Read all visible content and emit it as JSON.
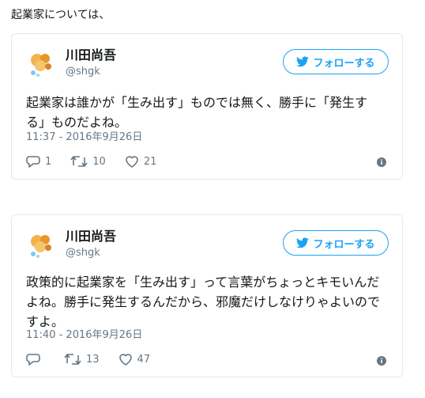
{
  "intro": "起業家については、",
  "colors": {
    "link_blue": "#1da1f2",
    "muted": "#657786",
    "border": "#e1e8ed"
  },
  "tweets": [
    {
      "author_name": "川田尚吾",
      "handle": "@shgk",
      "follow_label": "フォローする",
      "text": "起業家は誰かが「生み出す」ものでは無く、勝手に「発生する」ものだよね。",
      "timestamp": "11:37 - 2016年9月26日",
      "replies": "1",
      "retweets": "10",
      "likes": "21"
    },
    {
      "author_name": "川田尚吾",
      "handle": "@shgk",
      "follow_label": "フォローする",
      "text": "政策的に起業家を「生み出す」って言葉がちょっとキモいんだよね。勝手に発生するんだから、邪魔だけしなけりゃよいのですよ。",
      "timestamp": "11:40 - 2016年9月26日",
      "replies": "",
      "retweets": "13",
      "likes": "47"
    }
  ]
}
